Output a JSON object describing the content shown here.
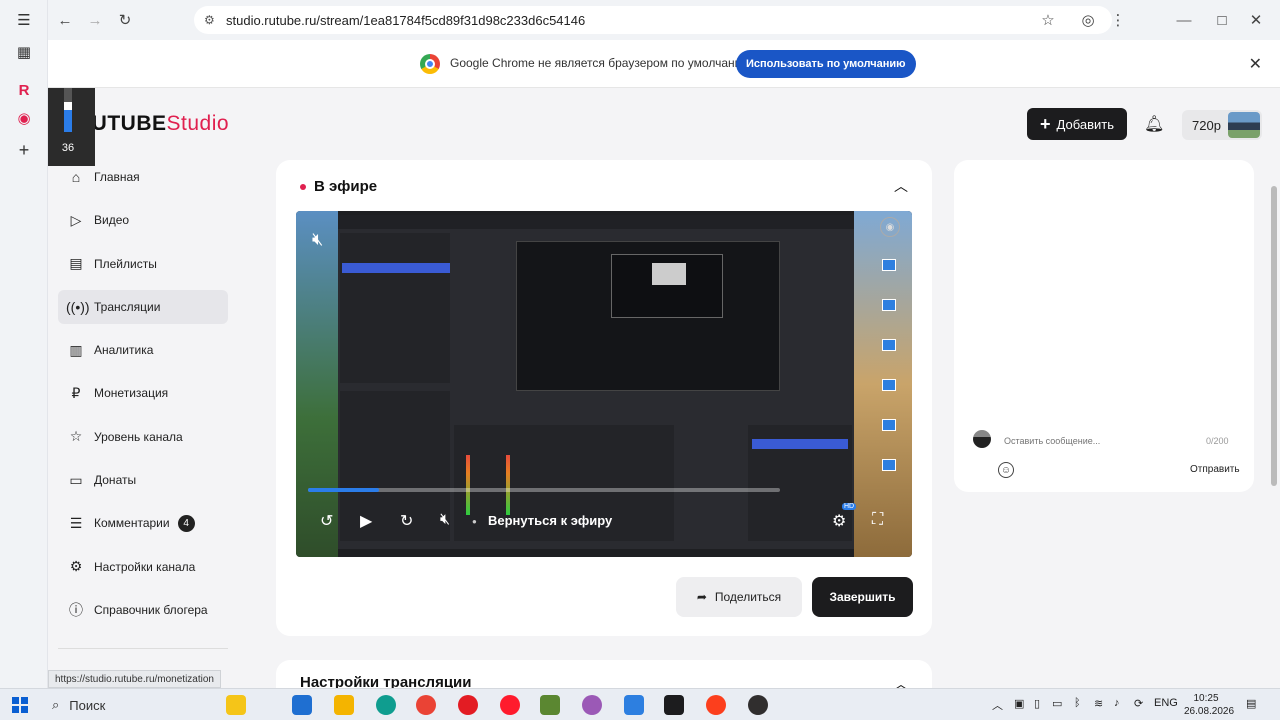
{
  "browser": {
    "url": "studio.rutube.ru/stream/1ea81784f5cd89f31d98c233d6c54146"
  },
  "infobar": {
    "message": "Google Chrome не является браузером по умолчанию.",
    "button": "Использовать по умолчанию"
  },
  "volume_osd": {
    "level": "36"
  },
  "logo": {
    "main": "RUTUBE",
    "studio": "Studio"
  },
  "header": {
    "add_label": "Добавить",
    "quality": "720p"
  },
  "sidebar": {
    "items": [
      {
        "label": "Главная",
        "icon": "home-icon"
      },
      {
        "label": "Видео",
        "icon": "video-icon"
      },
      {
        "label": "Плейлисты",
        "icon": "playlist-icon"
      },
      {
        "label": "Трансляции",
        "icon": "broadcast-icon"
      },
      {
        "label": "Аналитика",
        "icon": "analytics-icon"
      },
      {
        "label": "Монетизация",
        "icon": "ruble-icon"
      },
      {
        "label": "Уровень канала",
        "icon": "star-icon"
      },
      {
        "label": "Донаты",
        "icon": "donate-icon"
      },
      {
        "label": "Комментарии",
        "icon": "comments-icon",
        "badge": "4"
      },
      {
        "label": "Настройки канала",
        "icon": "gear-icon"
      },
      {
        "label": "Справочник блогера",
        "icon": "info-icon"
      }
    ]
  },
  "status_link": "https://studio.rutube.ru/monetization",
  "live": {
    "title": "В эфире",
    "back_to_live": "Вернуться к эфиру",
    "progress": 0.15,
    "share": "Поделиться",
    "finish": "Завершить"
  },
  "settings_card": {
    "title": "Настройки трансляции"
  },
  "chat": {
    "placeholder": "Оставить сообщение...",
    "counter": "0/200",
    "send": "Отправить"
  },
  "taskbar": {
    "search": "Поиск",
    "lang": "ENG",
    "time": "10:25",
    "date": "26.08.2026"
  },
  "colors": {
    "accent": "#e0204f",
    "primary_button": "#1c1c1e",
    "link_button": "#1a56c6"
  }
}
